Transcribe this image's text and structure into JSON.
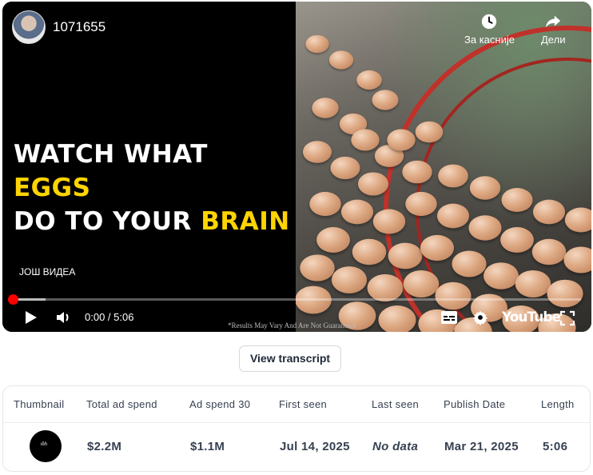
{
  "video": {
    "channel_name": "1071655",
    "actions": {
      "watch_later": "За касније",
      "share": "Дели"
    },
    "headline": {
      "line1_white": "WATCH WHAT ",
      "line1_yellow": "EGGS",
      "line2_white": "DO TO YOUR ",
      "line2_yellow": "BRAIN"
    },
    "more_videos": "ЈОШ ВИДЕА",
    "time": "0:00 / 5:06",
    "progress_fraction": 0,
    "disclaimer": "*Results May Vary And Are Not Guaranteed",
    "youtube_logo": "YouTube",
    "accent_color": "#ff0000",
    "highlight_color": "#ffd400"
  },
  "transcript_button": "View transcript",
  "table": {
    "headers": [
      "Thumbnail",
      "Total ad spend",
      "Ad spend 30",
      "First seen",
      "Last seen",
      "Publish Date",
      "Length"
    ],
    "row": {
      "thumbnail_text": "ιδh",
      "total_ad_spend": "$2.2M",
      "ad_spend_30": "$1.1M",
      "first_seen": "Jul 14, 2025",
      "last_seen": "No data",
      "publish_date": "Mar 21, 2025",
      "length": "5:06"
    }
  },
  "icons": [
    "clock-icon",
    "share-icon",
    "play-icon",
    "volume-icon",
    "captions-icon",
    "settings-icon",
    "fullscreen-icon"
  ]
}
